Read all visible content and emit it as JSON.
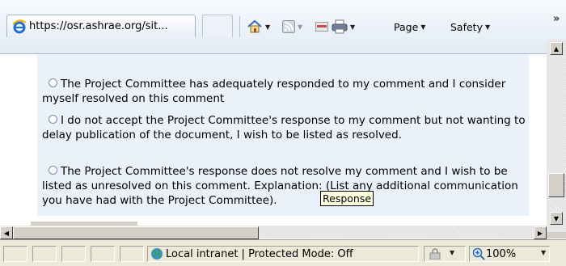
{
  "browser": {
    "tab_title": "https://osr.ashrae.org/sit...",
    "commands": {
      "page": "Page",
      "safety": "Safety"
    },
    "overflow": "»"
  },
  "content": {
    "options": [
      {
        "text": "The Project Committee has adequately responded to my comment and I consider myself resolved on this comment"
      },
      {
        "text": "I do not accept the Project Committee's response to my comment but not wanting to delay publication of the document, I wish to be listed as resolved."
      },
      {
        "text": "The Project Committee's response does not resolve my comment and I wish to be listed as unresolved on this comment. Explanation: (List any additional communication you have had with the Project Committee)."
      }
    ],
    "tooltip": "Response"
  },
  "status": {
    "zone": "Local intranet | Protected Mode: Off",
    "zoom": "100%"
  },
  "colors": {
    "panel_bg": "#eaf1fb",
    "toolbar_bg": "#e3ebf6",
    "tooltip_bg": "#ffffe1"
  }
}
